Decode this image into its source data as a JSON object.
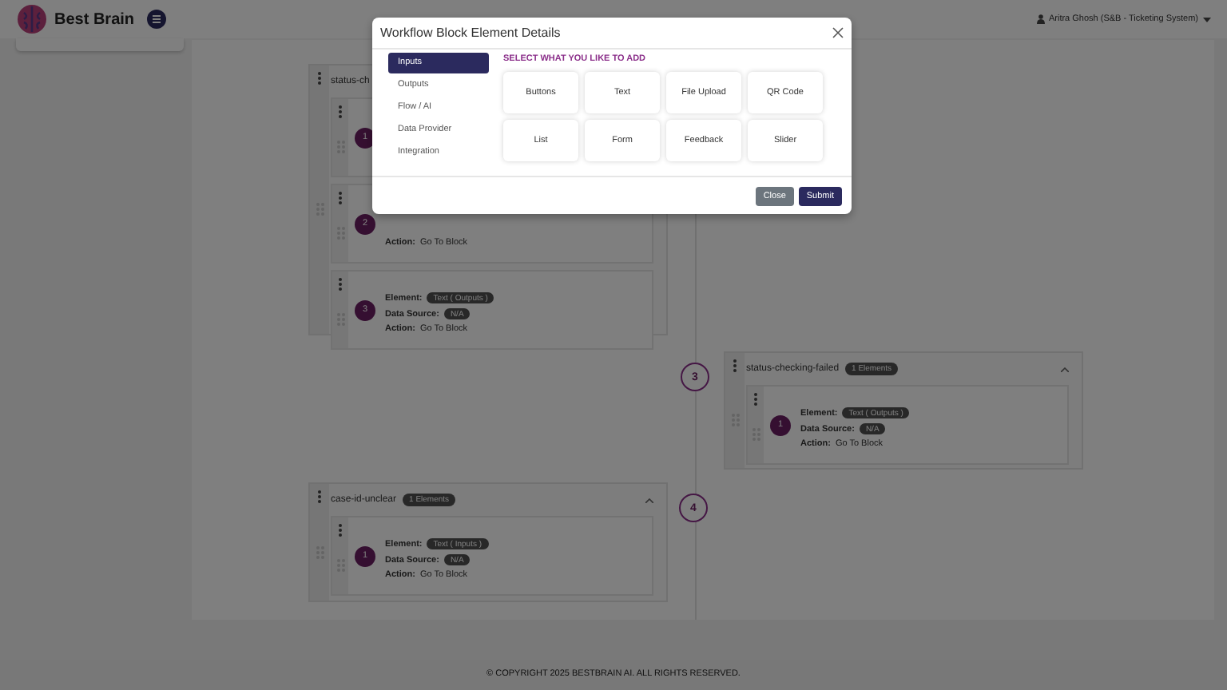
{
  "header": {
    "brand": "Best Brain",
    "user": "Aritra Ghosh (S&B - Ticketing System)"
  },
  "canvas": {
    "blocks": [
      {
        "title": "status-ch",
        "rows": [
          {
            "number": "1",
            "lines": []
          },
          {
            "number": "2",
            "lines": [
              {
                "label": "Action:",
                "value": "Go To Block",
                "kind": "text"
              }
            ]
          },
          {
            "number": "3",
            "lines": [
              {
                "label": "Element:",
                "value": "Text ( Outputs )",
                "kind": "tag"
              },
              {
                "label": "Data Source:",
                "value": "N/A",
                "kind": "tag"
              },
              {
                "label": "Action:",
                "value": "Go To Block",
                "kind": "text"
              }
            ]
          }
        ]
      },
      {
        "title": "status-checking-failed",
        "count": "1 Elements",
        "expanded": true,
        "marker": "3",
        "rows": [
          {
            "number": "1",
            "lines": [
              {
                "label": "Element:",
                "value": "Text ( Outputs )",
                "kind": "tag"
              },
              {
                "label": "Data Source:",
                "value": "N/A",
                "kind": "tag"
              },
              {
                "label": "Action:",
                "value": "Go To Block",
                "kind": "text"
              }
            ]
          }
        ]
      },
      {
        "title": "case-id-unclear",
        "count": "1 Elements",
        "expanded": true,
        "marker": "4",
        "rows": [
          {
            "number": "1",
            "lines": [
              {
                "label": "Element:",
                "value": "Text ( Inputs )",
                "kind": "tag"
              },
              {
                "label": "Data Source:",
                "value": "N/A",
                "kind": "tag"
              },
              {
                "label": "Action:",
                "value": "Go To Block",
                "kind": "text"
              }
            ]
          }
        ]
      }
    ]
  },
  "modal": {
    "title": "Workflow Block Element Details",
    "nav": [
      {
        "label": "Inputs",
        "selected": true
      },
      {
        "label": "Outputs",
        "selected": false
      },
      {
        "label": "Flow / AI",
        "selected": false
      },
      {
        "label": "Data Provider",
        "selected": false
      },
      {
        "label": "Integration",
        "selected": false
      }
    ],
    "heading": "SELECT WHAT YOU LIKE TO ADD",
    "options": [
      "Buttons",
      "Text",
      "File Upload",
      "QR Code",
      "List",
      "Form",
      "Feedback",
      "Slider"
    ],
    "buttons": [
      {
        "label": "Close",
        "kind": "secondary"
      },
      {
        "label": "Submit",
        "kind": "primary"
      }
    ]
  },
  "footer": {
    "copyright": "© COPYRIGHT 2025 BESTBRAIN AI. ALL RIGHTS RESERVED."
  }
}
